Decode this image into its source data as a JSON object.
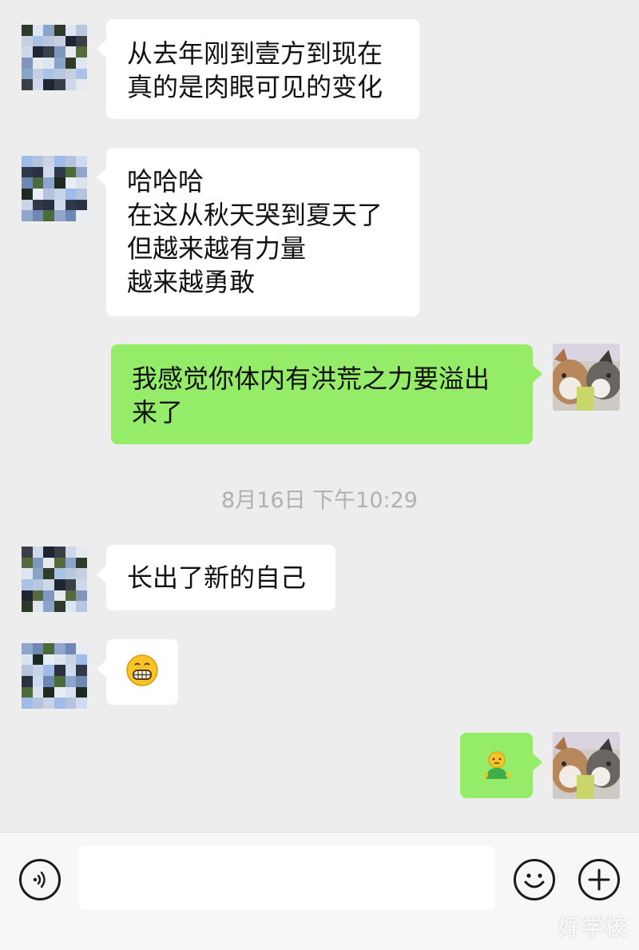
{
  "messages": [
    {
      "side": "left",
      "lines": [
        "从去年刚到壹方到现在",
        "真的是肉眼可见的变化"
      ]
    },
    {
      "side": "left",
      "lines": [
        "哈哈哈",
        "在这从秋天哭到夏天了",
        "但越来越有力量",
        "越来越勇敢"
      ]
    },
    {
      "side": "right",
      "lines": [
        "我感觉你体内有洪荒之力要溢出",
        "来了"
      ]
    },
    {
      "side": "left",
      "lines": [
        "长出了新的自己"
      ]
    },
    {
      "side": "left",
      "emoji": "😁"
    },
    {
      "side": "right",
      "emoji": "🙂"
    }
  ],
  "timestamp": "8月16日 下午10:29",
  "input_bar": {
    "voice_icon": "voice-icon",
    "emoji_icon": "emoji-icon",
    "plus_icon": "plus-icon",
    "input_value": ""
  },
  "watermark": "好学校",
  "colors": {
    "background": "#ededed",
    "incoming_bubble": "#ffffff",
    "outgoing_bubble": "#95ec69",
    "timestamp_text": "#b0b0b0"
  }
}
